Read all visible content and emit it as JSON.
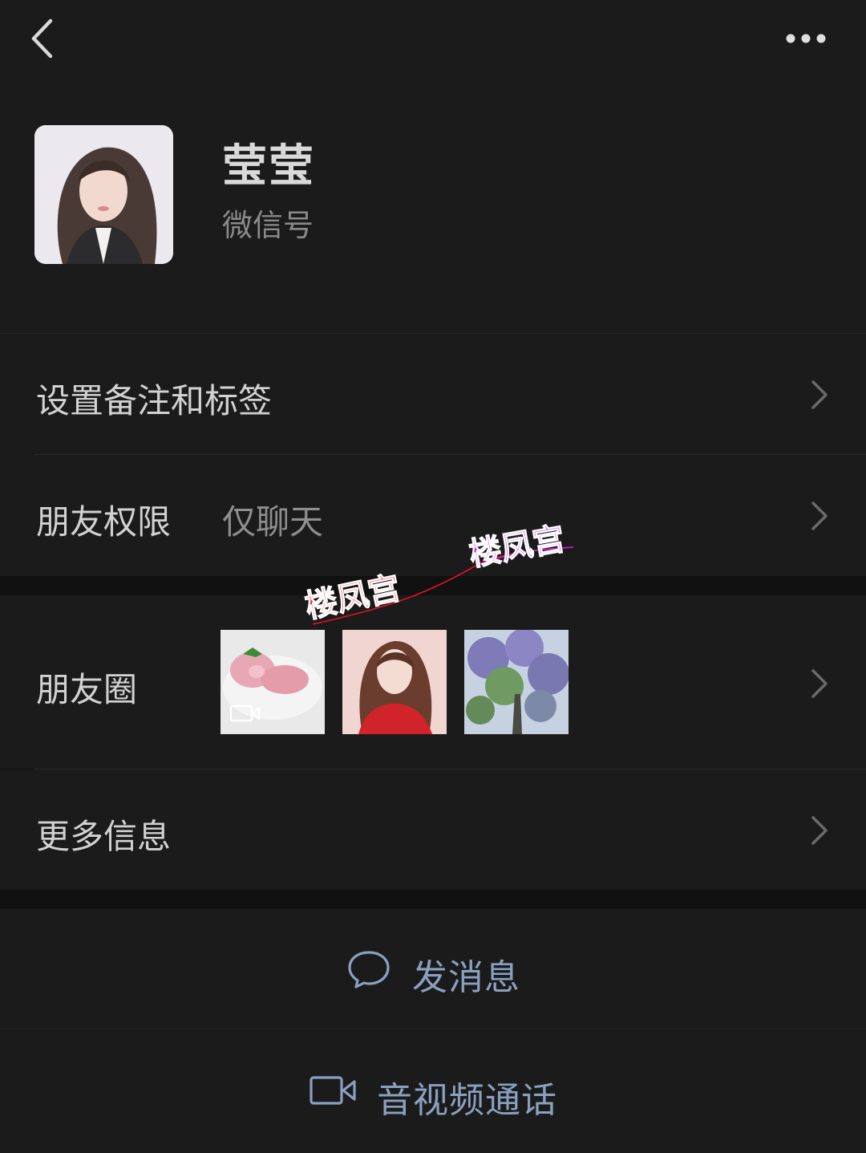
{
  "header": {
    "back_icon": "chevron-left-icon",
    "more_icon": "more-dots-icon"
  },
  "profile": {
    "name": "莹莹",
    "wechat_id_label": "微信号"
  },
  "cells": {
    "remark": {
      "label": "设置备注和标签"
    },
    "permission": {
      "label": "朋友权限",
      "value": "仅聊天"
    },
    "moments": {
      "label": "朋友圈"
    },
    "more_info": {
      "label": "更多信息"
    }
  },
  "watermark": {
    "text_left": "楼凤宫",
    "text_right": "楼凤宫"
  },
  "actions": {
    "message": "发消息",
    "call": "音视频通话"
  },
  "colors": {
    "background": "#111111",
    "cell": "#1b1b1b",
    "action_text": "#8aa0c0"
  }
}
